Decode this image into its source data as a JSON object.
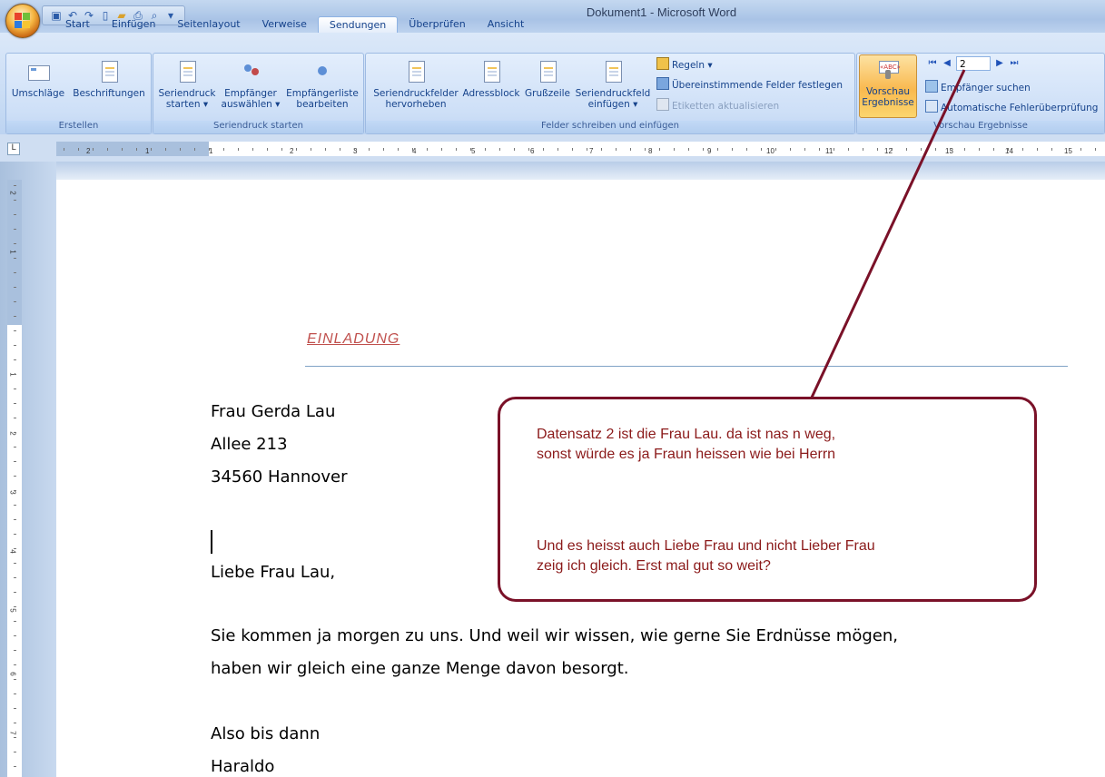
{
  "window": {
    "title": "Dokument1 - Microsoft Word"
  },
  "tabs": [
    "Start",
    "Einfügen",
    "Seitenlayout",
    "Verweise",
    "Sendungen",
    "Überprüfen",
    "Ansicht"
  ],
  "active_tab": "Sendungen",
  "ribbon": {
    "erstellen": {
      "label": "Erstellen",
      "umschlaege": "Umschläge",
      "beschriftungen": "Beschriftungen"
    },
    "seriendruck_starten": {
      "label": "Seriendruck starten",
      "starten_1": "Seriendruck",
      "starten_2": "starten ▾",
      "empfaenger_1": "Empfänger",
      "empfaenger_2": "auswählen ▾",
      "liste_1": "Empfängerliste",
      "liste_2": "bearbeiten"
    },
    "felder": {
      "label": "Felder schreiben und einfügen",
      "hervorheben_1": "Seriendruckfelder",
      "hervorheben_2": "hervorheben",
      "adressblock": "Adressblock",
      "grusszeile": "Grußzeile",
      "feld_1": "Seriendruckfeld",
      "feld_2": "einfügen ▾",
      "regeln": "Regeln ▾",
      "uebereinstimmende": "Übereinstimmende Felder festlegen",
      "etiketten": "Etiketten aktualisieren"
    },
    "vorschau": {
      "label": "Vorschau Ergebnisse",
      "vorschau_1": "Vorschau",
      "vorschau_2": "Ergebnisse",
      "record": "2",
      "empfaenger_suchen": "Empfänger suchen",
      "fehlerpruefung": "Automatische Fehlerüberprüfung"
    }
  },
  "ruler": {
    "h_ticks": [
      "2",
      "1",
      "1",
      "2",
      "3",
      "4",
      "5",
      "6",
      "7",
      "8",
      "9",
      "10",
      "11",
      "12",
      "13",
      "14",
      "15"
    ],
    "v_ticks": [
      "2",
      "1",
      "1",
      "2",
      "3",
      "4",
      "5",
      "6",
      "7"
    ]
  },
  "document": {
    "heading": "EINLADUNG",
    "address": [
      "Frau  Gerda Lau",
      "Allee 213",
      "34560  Hannover"
    ],
    "salutation": "Liebe Frau Lau,",
    "body": [
      "Sie kommen ja morgen zu uns. Und weil wir wissen, wie gerne Sie Erdnüsse mögen,",
      "haben wir gleich eine ganze Menge davon besorgt."
    ],
    "closing": [
      "Also bis dann",
      "Haraldo"
    ]
  },
  "callout": {
    "line1": "Datensatz 2 ist die Frau Lau. da ist nas n weg,",
    "line2": "sonst würde es ja Fraun heissen wie bei Herrn",
    "line3": "Und es heisst auch Liebe Frau und nicht Lieber Frau",
    "line4": "zeig ich gleich. Erst mal gut so weit?",
    "color": "#7a1128"
  }
}
